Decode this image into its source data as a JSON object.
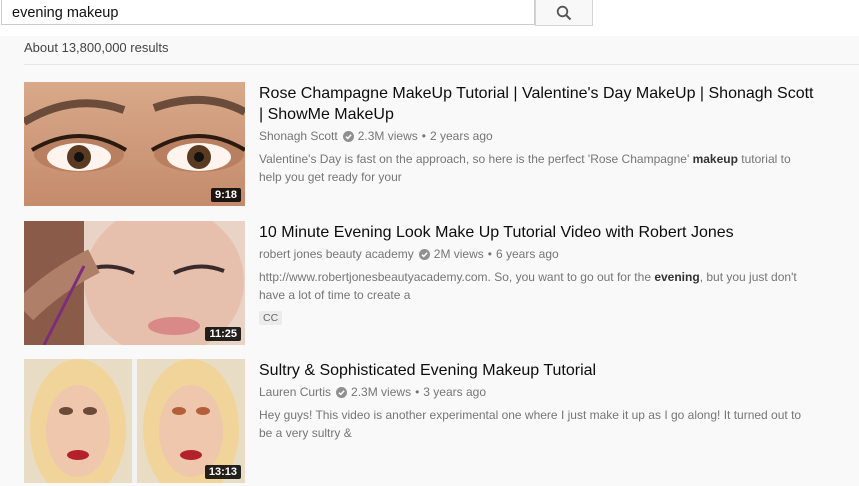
{
  "search": {
    "query": "evening makeup"
  },
  "results_count": "About 13,800,000 results",
  "results": [
    {
      "title": "Rose Champagne MakeUp Tutorial | Valentine's Day MakeUp | Shonagh Scott | ShowMe MakeUp",
      "channel": "Shonagh Scott",
      "views": "2.3M views",
      "age": "2 years ago",
      "desc_before": "Valentine's Day is fast on the approach, so here is the perfect 'Rose Champagne' ",
      "desc_bold": "makeup",
      "desc_after": " tutorial to help you get ready for your",
      "duration": "9:18"
    },
    {
      "title": "10 Minute Evening Look Make Up Tutorial Video with Robert Jones",
      "channel": "robert jones beauty academy",
      "views": "2M views",
      "age": "6 years ago",
      "desc_before": "http://www.robertjonesbeautyacademy.com. So, you want to go out for the ",
      "desc_bold": "evening",
      "desc_after": ", but you just don't have a lot of time to create a",
      "duration": "11:25",
      "badge": "CC"
    },
    {
      "title": "Sultry & Sophisticated Evening Makeup Tutorial",
      "channel": "Lauren Curtis",
      "views": "2.3M views",
      "age": "3 years ago",
      "desc_before": "Hey guys! This video is another experimental one where I just make it up as I go along! It turned out to be a very sultry &",
      "desc_bold": "",
      "desc_after": "",
      "duration": "13:13"
    }
  ],
  "icons": {
    "search": "search-icon",
    "verified": "verified-check-icon"
  },
  "colors": {
    "meta": "#767676",
    "background": "#f9f9f9"
  }
}
